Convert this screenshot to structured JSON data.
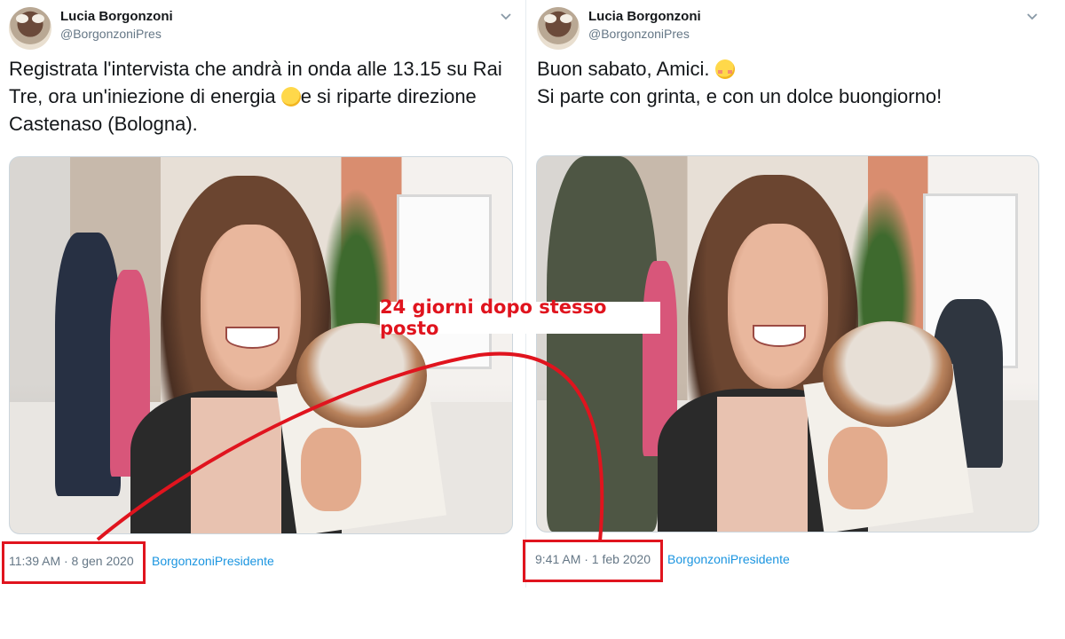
{
  "tweets": [
    {
      "author": {
        "name": "Lucia Borgonzoni",
        "handle": "@BorgonzoniPres"
      },
      "text_part1": "Registrata l'intervista che andrà in onda alle 13.15 su Rai\nTre, ora un'iniezione di energia ",
      "emoji": "face-savoring-food",
      "text_part2": "e si riparte direzione\nCastenaso (Bologna).",
      "timestamp": "11:39 AM · 8 gen 2020",
      "source": "BorgonzoniPresidente"
    },
    {
      "author": {
        "name": "Lucia Borgonzoni",
        "handle": "@BorgonzoniPres"
      },
      "text_part1": "Buon sabato, Amici. ",
      "emoji": "smiling-face-blush",
      "text_part2": "\nSi parte con grinta, e con un dolce buongiorno!",
      "timestamp": "9:41 AM · 1 feb 2020",
      "source": "BorgonzoniPresidente"
    }
  ],
  "annotation": {
    "label": "24 giorni dopo stesso posto",
    "color": "#e0141e"
  },
  "icons": {
    "menu": "chevron-down-icon"
  },
  "colors": {
    "name": "#14171a",
    "secondary": "#657786",
    "link": "#1b95e0",
    "annotation_red": "#e0141e"
  }
}
